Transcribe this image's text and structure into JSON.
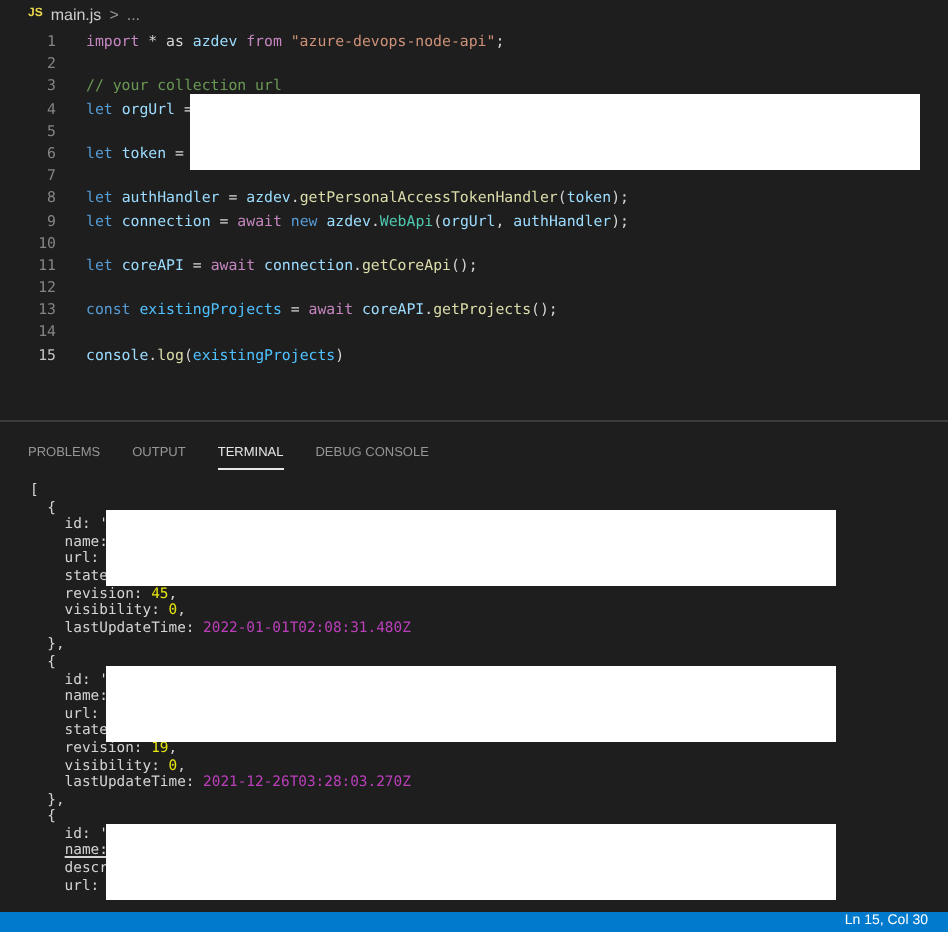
{
  "breadcrumb": {
    "file_icon": "JS",
    "file": "main.js",
    "separator": ">",
    "rest": "..."
  },
  "editor": {
    "lines": [
      {
        "number": "1",
        "selected": false,
        "tokens": [
          {
            "kind": "control",
            "text": "import"
          },
          {
            "kind": "plain",
            "text": " * as "
          },
          {
            "kind": "var",
            "text": "azdev "
          },
          {
            "kind": "control",
            "text": "from "
          },
          {
            "kind": "string",
            "text": "\"azure-devops-node-api\""
          },
          {
            "kind": "plain",
            "text": ";"
          }
        ]
      },
      {
        "number": "2",
        "selected": false
      },
      {
        "number": "3",
        "selected": false,
        "tokens": [
          {
            "kind": "comment",
            "text": "// your collection url"
          }
        ]
      },
      {
        "number": "4",
        "selected": false,
        "tokens": [
          {
            "kind": "keyword",
            "text": "let "
          },
          {
            "kind": "var",
            "text": "orgUrl"
          },
          {
            "kind": "plain",
            "text": " ="
          }
        ]
      },
      {
        "number": "5",
        "selected": false
      },
      {
        "number": "6",
        "selected": false,
        "tokens": [
          {
            "kind": "keyword",
            "text": "let "
          },
          {
            "kind": "var",
            "text": "token"
          },
          {
            "kind": "plain",
            "text": " ="
          }
        ]
      },
      {
        "number": "7",
        "selected": false
      },
      {
        "number": "8",
        "selected": false,
        "tokens": [
          {
            "kind": "keyword",
            "text": "let "
          },
          {
            "kind": "var",
            "text": "authHandler"
          },
          {
            "kind": "plain",
            "text": " = "
          },
          {
            "kind": "var",
            "text": "azdev"
          },
          {
            "kind": "plain",
            "text": "."
          },
          {
            "kind": "func",
            "text": "getPersonalAccessTokenHandler"
          },
          {
            "kind": "plain",
            "text": "("
          },
          {
            "kind": "var",
            "text": "token"
          },
          {
            "kind": "plain",
            "text": ");"
          }
        ]
      },
      {
        "number": "9",
        "selected": false,
        "tokens": [
          {
            "kind": "keyword",
            "text": "let "
          },
          {
            "kind": "var",
            "text": "connection"
          },
          {
            "kind": "plain",
            "text": " = "
          },
          {
            "kind": "control",
            "text": "await "
          },
          {
            "kind": "keyword",
            "text": "new "
          },
          {
            "kind": "var",
            "text": "azdev"
          },
          {
            "kind": "plain",
            "text": "."
          },
          {
            "kind": "class",
            "text": "WebApi"
          },
          {
            "kind": "plain",
            "text": "("
          },
          {
            "kind": "var",
            "text": "orgUrl"
          },
          {
            "kind": "plain",
            "text": ", "
          },
          {
            "kind": "var",
            "text": "authHandler"
          },
          {
            "kind": "plain",
            "text": ");"
          }
        ]
      },
      {
        "number": "10",
        "selected": false
      },
      {
        "number": "11",
        "selected": false,
        "tokens": [
          {
            "kind": "keyword",
            "text": "let "
          },
          {
            "kind": "var",
            "text": "coreAPI"
          },
          {
            "kind": "plain",
            "text": " = "
          },
          {
            "kind": "control",
            "text": "await "
          },
          {
            "kind": "var",
            "text": "connection"
          },
          {
            "kind": "plain",
            "text": "."
          },
          {
            "kind": "func",
            "text": "getCoreApi"
          },
          {
            "kind": "plain",
            "text": "();"
          }
        ]
      },
      {
        "number": "12",
        "selected": false
      },
      {
        "number": "13",
        "selected": false,
        "tokens": [
          {
            "kind": "keyword",
            "text": "const "
          },
          {
            "kind": "const",
            "text": "existingProjects"
          },
          {
            "kind": "plain",
            "text": " = "
          },
          {
            "kind": "control",
            "text": "await "
          },
          {
            "kind": "var",
            "text": "coreAPI"
          },
          {
            "kind": "plain",
            "text": "."
          },
          {
            "kind": "func",
            "text": "getProjects"
          },
          {
            "kind": "plain",
            "text": "();"
          }
        ]
      },
      {
        "number": "14",
        "selected": false
      },
      {
        "number": "15",
        "selected": true,
        "tokens": [
          {
            "kind": "var",
            "text": "console"
          },
          {
            "kind": "plain",
            "text": "."
          },
          {
            "kind": "func",
            "text": "log"
          },
          {
            "kind": "plain",
            "text": "("
          },
          {
            "kind": "const",
            "text": "existingProjects"
          },
          {
            "kind": "plain",
            "text": ")"
          }
        ]
      }
    ]
  },
  "panel": {
    "tabs": [
      {
        "label": "PROBLEMS",
        "selected": false
      },
      {
        "label": "OUTPUT",
        "selected": false
      },
      {
        "label": "TERMINAL",
        "selected": true
      },
      {
        "label": "DEBUG CONSOLE",
        "selected": false
      }
    ]
  },
  "terminal": {
    "lines": [
      [
        {
          "kind": "plain",
          "text": "["
        }
      ],
      [
        {
          "kind": "plain",
          "text": "  {"
        }
      ],
      [
        {
          "kind": "plain",
          "text": "    id: '"
        }
      ],
      [
        {
          "kind": "plain",
          "text": "    name:"
        }
      ],
      [
        {
          "kind": "plain",
          "text": "    url:"
        }
      ],
      [
        {
          "kind": "plain",
          "text": "    state"
        }
      ],
      [
        {
          "kind": "plain",
          "text": "    revision: "
        },
        {
          "kind": "number",
          "text": "45"
        },
        {
          "kind": "plain",
          "text": ","
        }
      ],
      [
        {
          "kind": "plain",
          "text": "    visibility: "
        },
        {
          "kind": "number",
          "text": "0"
        },
        {
          "kind": "plain",
          "text": ","
        }
      ],
      [
        {
          "kind": "plain",
          "text": "    lastUpdateTime: "
        },
        {
          "kind": "date",
          "text": "2022-01-01T02:08:31.480Z"
        }
      ],
      [
        {
          "kind": "plain",
          "text": "  },"
        }
      ],
      [
        {
          "kind": "plain",
          "text": "  {"
        }
      ],
      [
        {
          "kind": "plain",
          "text": "    id: '"
        }
      ],
      [
        {
          "kind": "plain",
          "text": "    name:"
        }
      ],
      [
        {
          "kind": "plain",
          "text": "    url:"
        }
      ],
      [
        {
          "kind": "plain",
          "text": "    state"
        }
      ],
      [
        {
          "kind": "plain",
          "text": "    revision: "
        },
        {
          "kind": "number",
          "text": "19"
        },
        {
          "kind": "plain",
          "text": ","
        }
      ],
      [
        {
          "kind": "plain",
          "text": "    visibility: "
        },
        {
          "kind": "number",
          "text": "0"
        },
        {
          "kind": "plain",
          "text": ","
        }
      ],
      [
        {
          "kind": "plain",
          "text": "    lastUpdateTime: "
        },
        {
          "kind": "date",
          "text": "2021-12-26T03:28:03.270Z"
        }
      ],
      [
        {
          "kind": "plain",
          "text": "  },"
        }
      ],
      [
        {
          "kind": "plain",
          "text": "  {"
        }
      ],
      [
        {
          "kind": "plain",
          "text": "    id: '"
        }
      ],
      [
        {
          "kind": "link",
          "text": "    name:"
        }
      ],
      [
        {
          "kind": "plain",
          "text": "    descr"
        }
      ],
      [
        {
          "kind": "plain",
          "text": "    url:"
        }
      ]
    ]
  },
  "status_bar": {
    "position": "Ln 15, Col 30"
  }
}
